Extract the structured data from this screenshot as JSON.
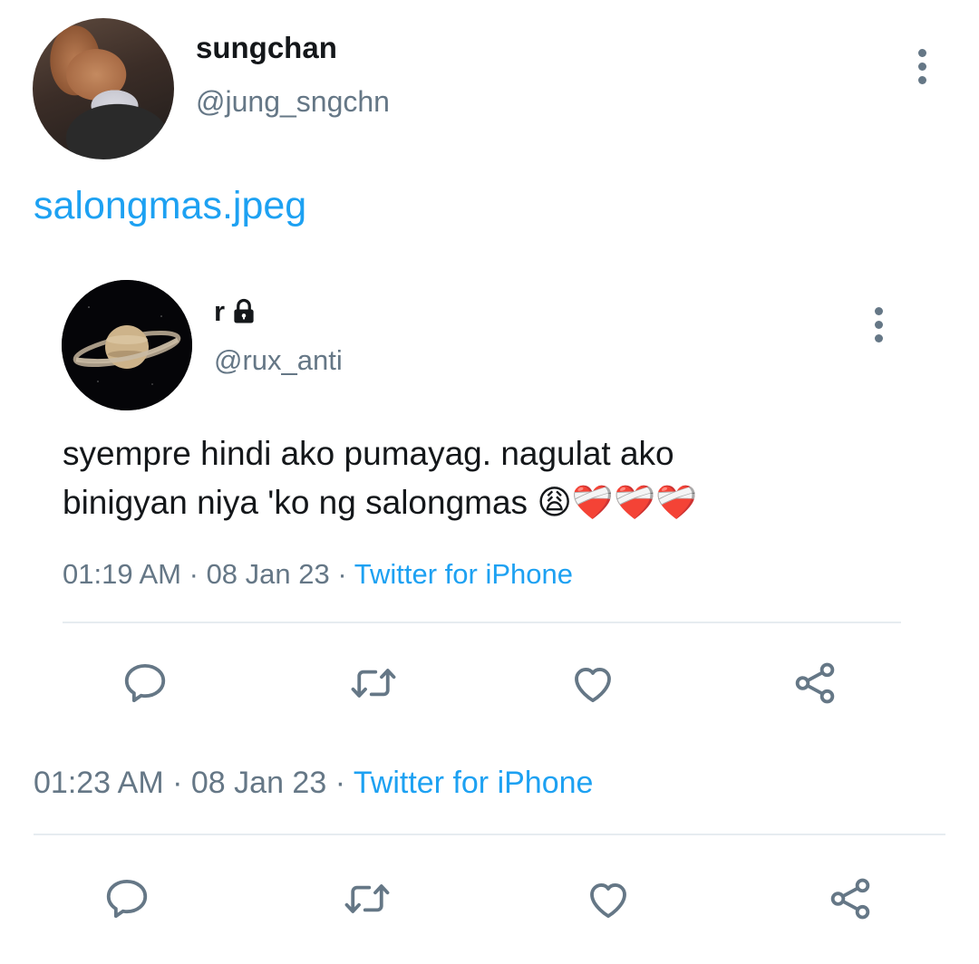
{
  "outer_tweet": {
    "author_name": "sungchan",
    "author_handle": "@jung_sngchn",
    "link_text": "salongmas.jpeg",
    "time": "01:23 AM",
    "separator": "·",
    "date": "08 Jan 23",
    "source": "Twitter for iPhone"
  },
  "quoted_tweet": {
    "author_name": "r",
    "author_handle": "@rux_anti",
    "text_line1": "syempre hindi ako pumayag. nagulat ako",
    "text_line2": "binigyan niya 'ko ng salongmas",
    "emojis": "😩❤️‍🩹❤️‍🩹❤️‍🩹",
    "time": "01:19 AM",
    "separator": "·",
    "date": "08 Jan 23",
    "source": "Twitter for iPhone"
  },
  "icons": {
    "reply": "speech-bubble-icon",
    "retweet": "retweet-icon",
    "like": "heart-icon",
    "share": "share-icon",
    "more": "kebab-menu-icon",
    "lock": "lock-icon"
  },
  "colors": {
    "accent": "#1da1f2",
    "secondary_text": "#657786",
    "divider": "#e6ecf0"
  }
}
